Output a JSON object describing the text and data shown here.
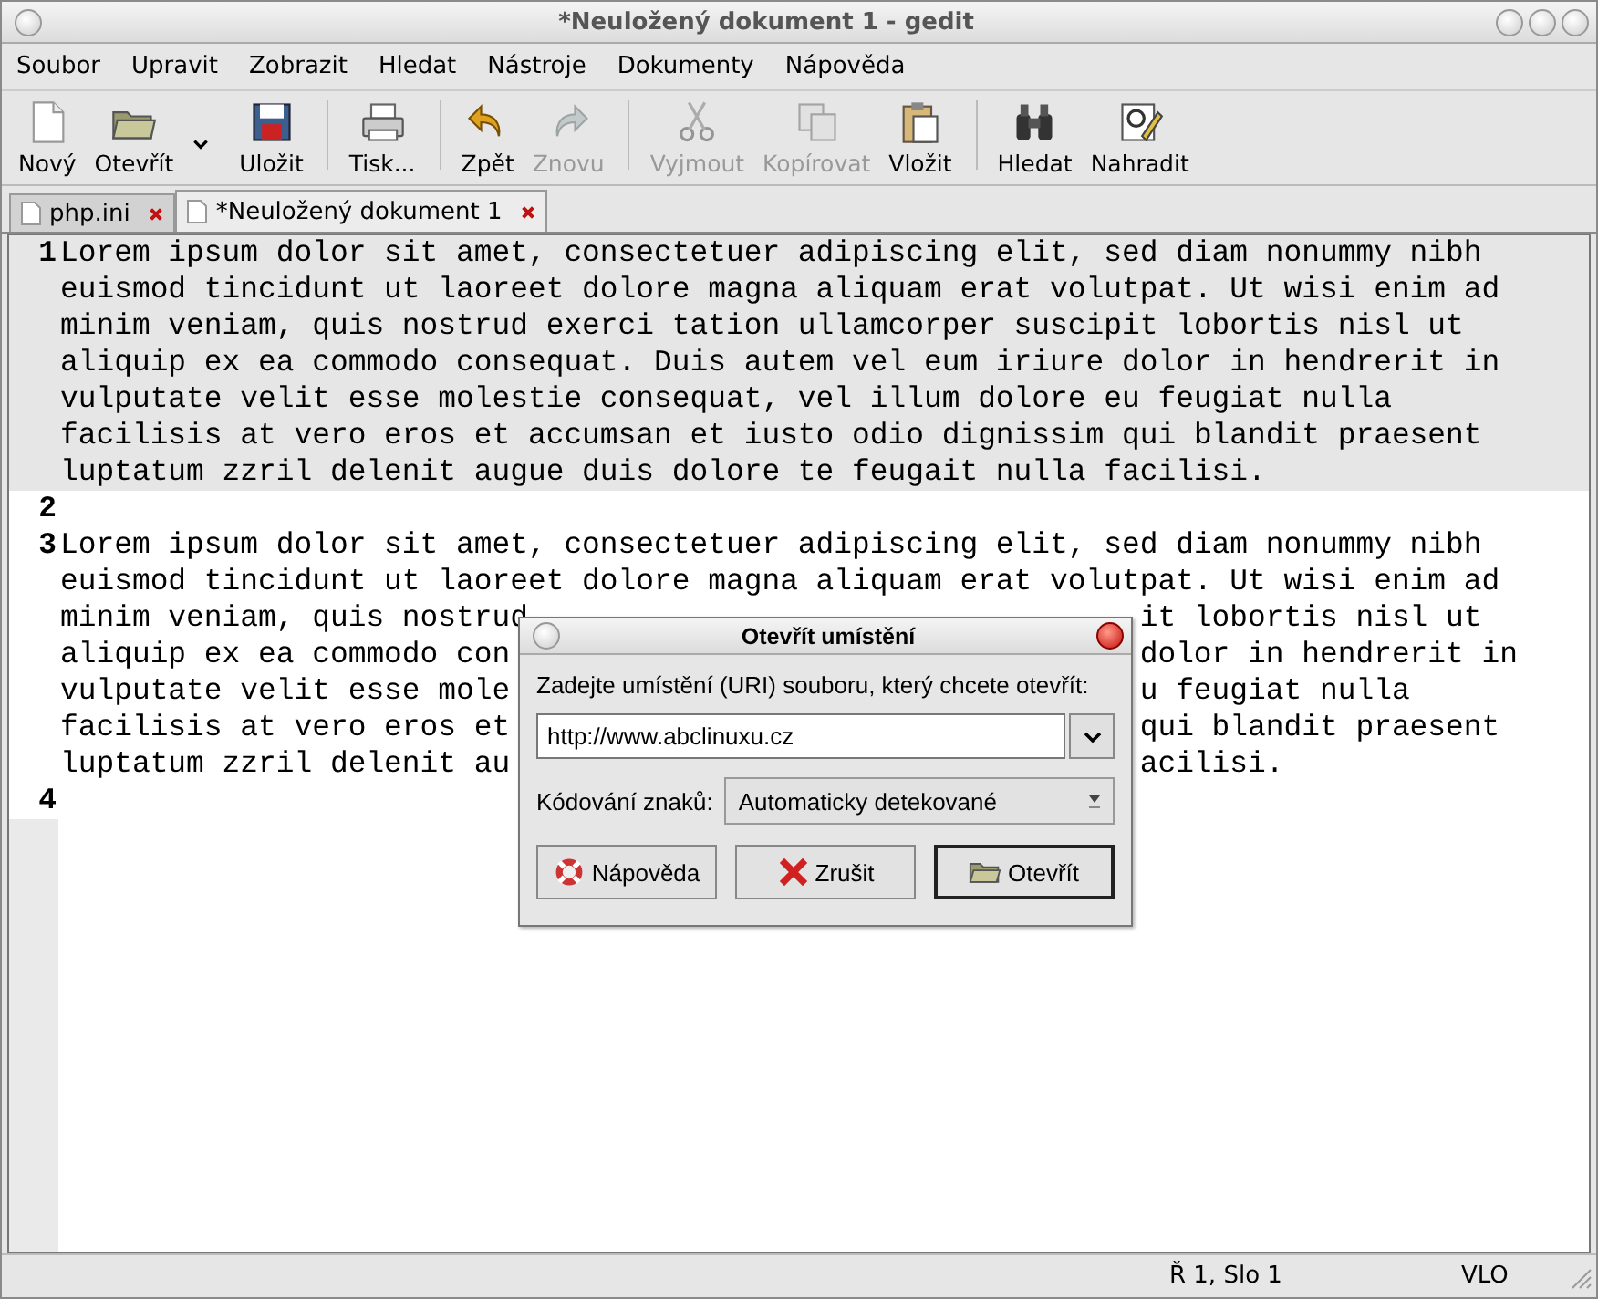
{
  "window": {
    "title": "*Neuložený dokument 1 - gedit"
  },
  "menu": [
    "Soubor",
    "Upravit",
    "Zobrazit",
    "Hledat",
    "Nástroje",
    "Dokumenty",
    "Nápověda"
  ],
  "toolbar": [
    {
      "kind": "button",
      "label": "Nový",
      "disabled": false
    },
    {
      "kind": "button",
      "label": "Otevřít",
      "disabled": false
    },
    {
      "kind": "arrow"
    },
    {
      "kind": "button",
      "label": "Uložit",
      "disabled": false
    },
    {
      "kind": "separator"
    },
    {
      "kind": "button",
      "label": "Tisk...",
      "disabled": false
    },
    {
      "kind": "separator"
    },
    {
      "kind": "button",
      "label": "Zpět",
      "disabled": false
    },
    {
      "kind": "button",
      "label": "Znovu",
      "disabled": true
    },
    {
      "kind": "separator"
    },
    {
      "kind": "button",
      "label": "Vyjmout",
      "disabled": true
    },
    {
      "kind": "button",
      "label": "Kopírovat",
      "disabled": true
    },
    {
      "kind": "button",
      "label": "Vložit",
      "disabled": false
    },
    {
      "kind": "separator"
    },
    {
      "kind": "button",
      "label": "Hledat",
      "disabled": false
    },
    {
      "kind": "button",
      "label": "Nahradit",
      "disabled": false
    }
  ],
  "tabs": [
    {
      "label": "php.ini",
      "selected": false
    },
    {
      "label": "*Neuložený dokument 1",
      "selected": true
    }
  ],
  "editor": {
    "lines": [
      {
        "number": "1",
        "current": true,
        "text": "Lorem ipsum dolor sit amet, consectetuer adipiscing elit, sed diam nonummy nibh euismod tincidunt ut laoreet dolore magna aliquam erat volutpat. Ut wisi enim ad minim veniam, quis nostrud exerci tation ullamcorper suscipit lobortis nisl ut aliquip ex ea commodo consequat. Duis autem vel eum iriure dolor in hendrerit in vulputate velit esse molestie consequat, vel illum dolore eu feugiat nulla facilisis at vero eros et accumsan et iusto odio dignissim qui blandit praesent luptatum zzril delenit augue duis dolore te feugait nulla facilisi."
      },
      {
        "number": "2",
        "current": false
      },
      {
        "number": "3",
        "current": false,
        "visible_rows": [
          {
            "left": "Lorem ipsum dolor sit amet, consectetuer adipiscing elit, sed diam nonummy nibh"
          },
          {
            "left": "euismod tincidunt ut laoreet dolore magna aliquam erat volutpat. Ut wisi enim ad"
          },
          {
            "left": "minim veniam, quis nostrud",
            "right": "it lobortis nisl ut"
          },
          {
            "left": "aliquip ex ea commodo con",
            "right": "dolor in hendrerit in"
          },
          {
            "left": "vulputate velit esse mole",
            "right": "u feugiat nulla"
          },
          {
            "left": "facilisis at vero eros et",
            "right": "qui blandit praesent"
          },
          {
            "left": "luptatum zzril delenit au",
            "right": "acilisi."
          }
        ]
      },
      {
        "number": "4",
        "current": false
      }
    ]
  },
  "dialog": {
    "title": "Otevřít umístění",
    "prompt": "Zadejte umístění (URI) souboru, který chcete otevřít:",
    "location": "http://www.abclinuxu.cz",
    "encoding_label": "Kódování znaků:",
    "encoding": "Automaticky detekované",
    "buttons": [
      {
        "label": "Nápověda",
        "default": false
      },
      {
        "label": "Zrušit",
        "default": false
      },
      {
        "label": "Otevřít",
        "default": true
      }
    ]
  },
  "status_bar": {
    "position": "Ř 1, Slo 1",
    "mode": "VLO"
  }
}
